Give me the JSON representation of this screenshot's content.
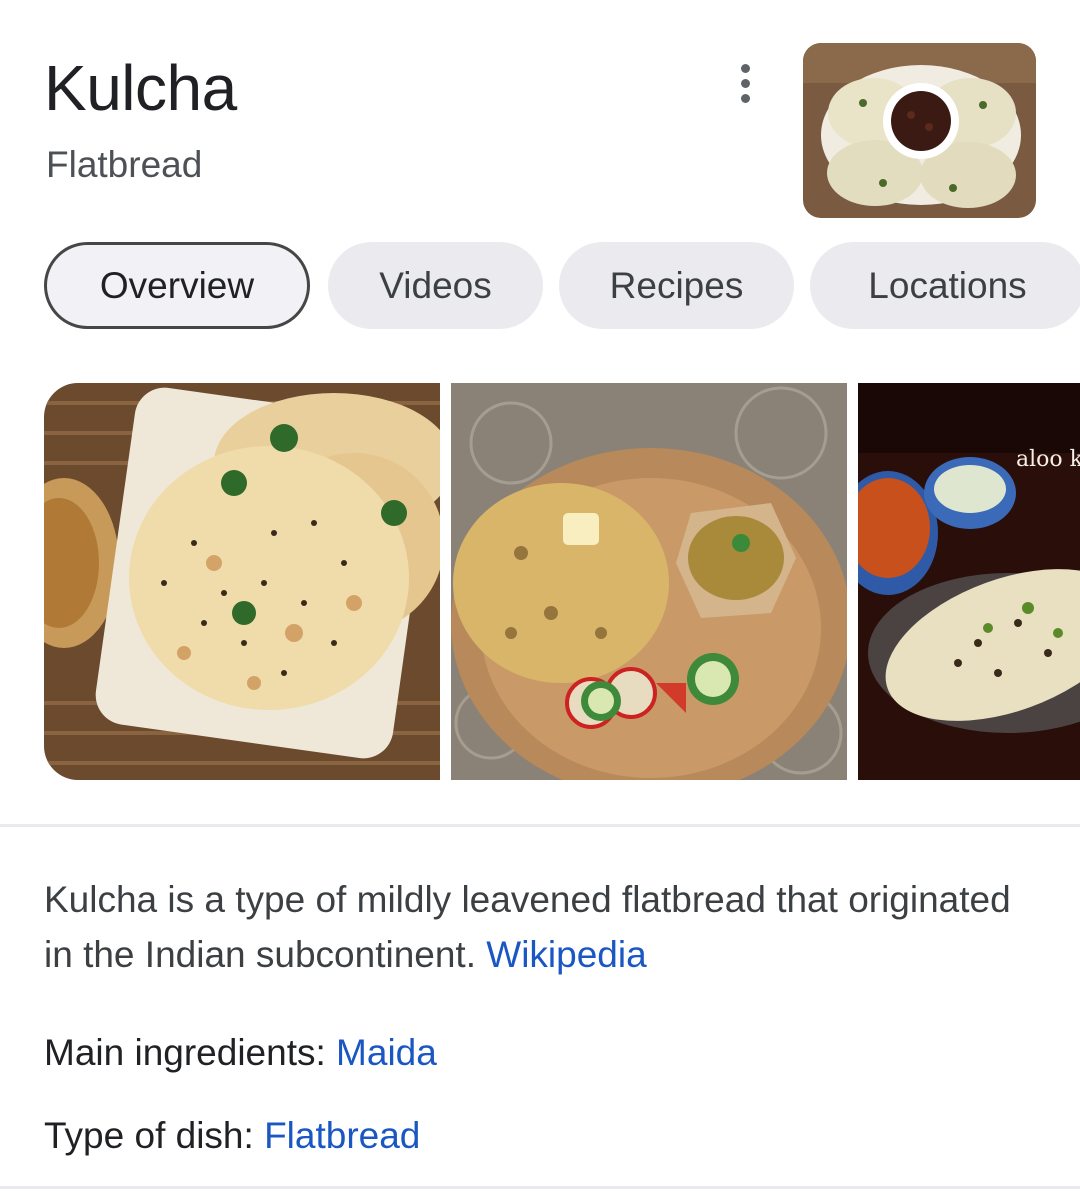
{
  "header": {
    "title": "Kulcha",
    "subtitle": "Flatbread",
    "more_icon": "more-vert-icon"
  },
  "tabs": [
    {
      "label": "Overview",
      "active": true
    },
    {
      "label": "Videos",
      "active": false
    },
    {
      "label": "Recipes",
      "active": false
    },
    {
      "label": "Locations",
      "active": false
    }
  ],
  "gallery": {
    "images": [
      {
        "subject": "kulcha-on-plate"
      },
      {
        "subject": "kulcha-with-chole"
      },
      {
        "subject": "aloo-kulcha",
        "overlay_text": "aloo k"
      }
    ]
  },
  "description": {
    "text": "Kulcha is a type of mildly leavened flatbread that originated in the Indian subcontinent.",
    "source": "Wikipedia"
  },
  "facts": {
    "ingredients_label": "Main ingredients: ",
    "ingredients_value": "Maida",
    "dish_label": "Type of dish: ",
    "dish_value": "Flatbread"
  },
  "colors": {
    "link": "#1a57c2",
    "tab_bg": "#ebebef",
    "active_tab_border": "#444746"
  }
}
